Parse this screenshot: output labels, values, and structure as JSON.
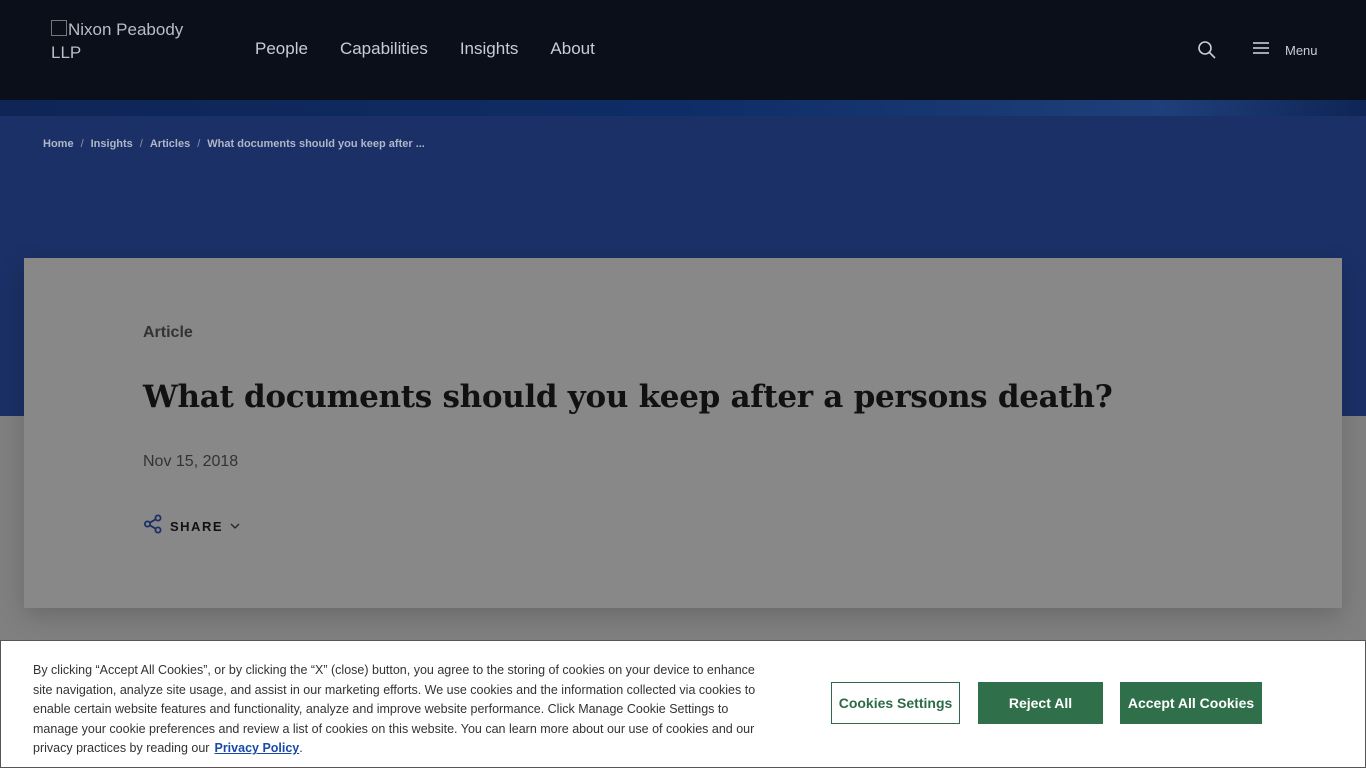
{
  "header": {
    "logo_text": "Nixon Peabody LLP",
    "nav": [
      "People",
      "Capabilities",
      "Insights",
      "About"
    ],
    "search_icon": "search-icon",
    "menu_label": "Menu",
    "menu_icon": "hamburger-icon"
  },
  "breadcrumb": [
    "Home",
    "Insights",
    "Articles",
    "What documents should you keep after ..."
  ],
  "article": {
    "type": "Article",
    "title": "What documents should you keep after a persons death?",
    "date": "Nov 15, 2018",
    "share_label": "SHARE",
    "share_icon": "share-icon",
    "share_chevron": "chevron-down-icon"
  },
  "cookie_banner": {
    "text": "By clicking “Accept All Cookies”, or by clicking the “X” (close) button, you agree to the storing of cookies on your device to enhance site navigation, analyze site usage, and assist in our marketing efforts. We use cookies and the information collected via cookies to enable certain website features and functionality, analyze and improve website performance. Click Manage Cookie Settings to manage your cookie preferences and review a list of cookies on this website. You can learn more about our use of cookies and our privacy practices by reading our",
    "privacy_link": "Privacy Policy",
    "settings_button": "Cookies Settings",
    "reject_button": "Reject All",
    "accept_button": "Accept All Cookies"
  },
  "colors": {
    "header_bg": "#0b0f1a",
    "hero_bg": "#1b3066",
    "button_green": "#2f6f49",
    "link_blue": "#1a49a9"
  }
}
